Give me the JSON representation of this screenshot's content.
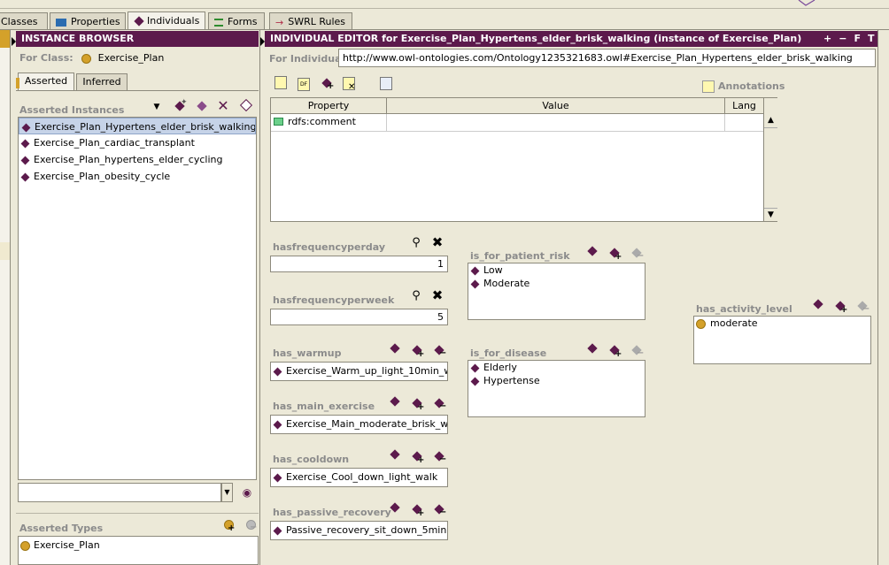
{
  "tabs": [
    {
      "label": "Classes",
      "icon": "class-icon"
    },
    {
      "label": "Properties",
      "icon": "properties-icon"
    },
    {
      "label": "Individuals",
      "icon": "individuals-icon"
    },
    {
      "label": "Forms",
      "icon": "forms-icon"
    },
    {
      "label": "SWRL Rules",
      "icon": "swrl-icon"
    }
  ],
  "instance_browser": {
    "title": "INSTANCE BROWSER",
    "for_class_label": "For Class:",
    "for_class_value": "Exercise_Plan",
    "subtabs": [
      "Asserted",
      "Inferred"
    ],
    "asserted_instances_label": "Asserted Instances",
    "instances": [
      "Exercise_Plan_Hypertens_elder_brisk_walking",
      "Exercise_Plan_cardiac_transplant",
      "Exercise_Plan_hypertens_elder_cycling",
      "Exercise_Plan_obesity_cycle"
    ],
    "selected_index": 0,
    "search_value": "",
    "asserted_types_label": "Asserted Types",
    "types": [
      "Exercise_Plan"
    ]
  },
  "individual_editor": {
    "title": "INDIVIDUAL EDITOR for Exercise_Plan_Hypertens_elder_brisk_walking   (instance of Exercise_Plan)",
    "header_buttons": [
      "+",
      "−",
      "F",
      "T"
    ],
    "for_individual_label": "For Individual:",
    "for_individual_value": "http://www.owl-ontologies.com/Ontology1235321683.owl#Exercise_Plan_Hypertens_elder_brisk_walking",
    "annotations_label": "Annotations",
    "table_headers": {
      "property": "Property",
      "value": "Value",
      "lang": "Lang"
    },
    "table_rows": [
      {
        "property": "rdfs:comment",
        "value": "",
        "lang": ""
      }
    ]
  },
  "fields": {
    "hasfrequencyperday": {
      "label": "hasfrequencyperday",
      "value": "1"
    },
    "hasfrequencyperweek": {
      "label": "hasfrequencyperweek",
      "value": "5"
    },
    "has_warmup": {
      "label": "has_warmup",
      "value": "Exercise_Warm_up_light_10min_w..."
    },
    "has_main_exercise": {
      "label": "has_main_exercise",
      "value": "Exercise_Main_moderate_brisk_wa..."
    },
    "has_cooldown": {
      "label": "has_cooldown",
      "value": "Exercise_Cool_down_light_walk"
    },
    "has_passive_recovery": {
      "label": "has_passive_recovery",
      "value": "Passive_recovery_sit_down_5min"
    },
    "is_for_patient_risk": {
      "label": "is_for_patient_risk",
      "values": [
        "Low",
        "Moderate"
      ]
    },
    "is_for_disease": {
      "label": "is_for_disease",
      "values": [
        "Elderly",
        "Hypertense"
      ]
    },
    "has_activity_level": {
      "label": "has_activity_level",
      "values": [
        "moderate"
      ]
    }
  },
  "colors": {
    "header_purple": "#5c1a4c",
    "panel_bg": "#ece9d8",
    "selection": "#c6d3e8",
    "class_ball": "#d4a12a"
  }
}
